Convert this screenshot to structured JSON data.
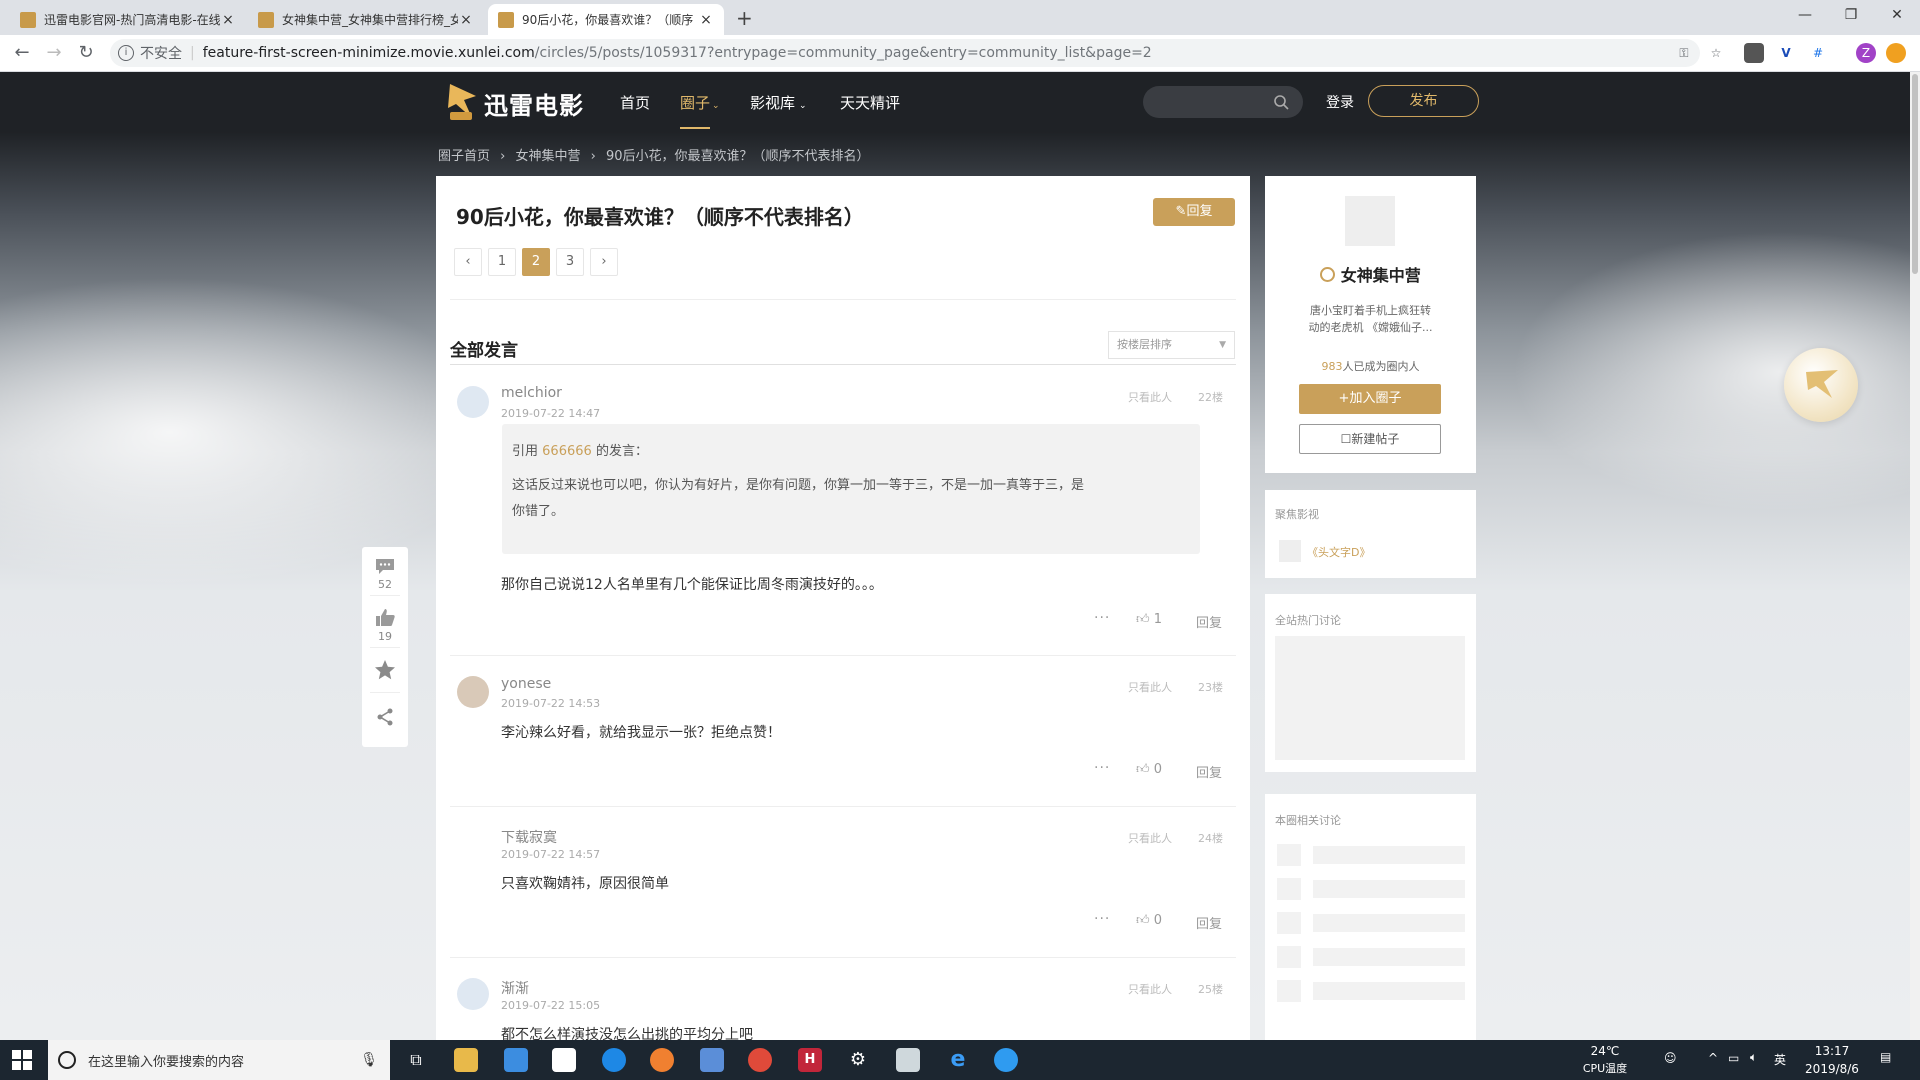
{
  "browser": {
    "tabs": [
      {
        "title": "迅雷电影官网-热门高清电影-在线"
      },
      {
        "title": "女神集中营_女神集中营排行榜_女"
      },
      {
        "title": "90后小花，你最喜欢谁？（顺序"
      }
    ],
    "new_tab": "+",
    "close_glyph": "×",
    "window": {
      "minimize": "—",
      "maximize": "❐",
      "close": "✕"
    },
    "nav": {
      "back": "←",
      "forward": "→",
      "reload": "↻"
    },
    "security_label": "不安全",
    "url_host": "feature-first-screen-minimize.movie.xunlei.com",
    "url_path": "/circles/5/posts/1059317?entrypage=community_page&entry=community_list&page=2",
    "profile_initial": "Z"
  },
  "site": {
    "logo_text": "迅雷电影",
    "nav": [
      "首页",
      "圈子",
      "影视库",
      "天天精评"
    ],
    "nav_active_index": 1,
    "login": "登录",
    "publish": "发布",
    "accent_color": "#c9a05a"
  },
  "breadcrumb": [
    "圈子首页",
    "女神集中营",
    "90后小花，你最喜欢谁？（顺序不代表排名）"
  ],
  "post": {
    "title": "90后小花，你最喜欢谁？（顺序不代表排名）",
    "reply_button": "回复",
    "pages": [
      "1",
      "2",
      "3"
    ],
    "current_page": "2",
    "prev": "‹",
    "next": "›"
  },
  "comments_header": {
    "title": "全部发言",
    "sort": "按楼层排序"
  },
  "comments": [
    {
      "user": "melchior",
      "time": "2019-07-22 14:47",
      "only": "只看此人",
      "floor": "22楼",
      "quote_prefix": "引用",
      "quote_user": "666666",
      "quote_suffix": "的发言：",
      "quote_text_1": "这话反过来说也可以吧，你认为有好片，是你有问题，你算一加一等于三，不是一加一真等于三，是",
      "quote_text_2": "你错了。",
      "text": "那你自己说说12人名单里有几个能保证比周冬雨演技好的。。。",
      "more": "···",
      "likes": "1",
      "reply": "回复"
    },
    {
      "user": "yonese",
      "time": "2019-07-22 14:53",
      "only": "只看此人",
      "floor": "23楼",
      "text": "李沁辣么好看，就给我显示一张？拒绝点赞！",
      "more": "···",
      "likes": "0",
      "reply": "回复"
    },
    {
      "user": "下载寂寞",
      "time": "2019-07-22 14:57",
      "only": "只看此人",
      "floor": "24楼",
      "text": "只喜欢鞠婧祎，原因很简单",
      "more": "···",
      "likes": "0",
      "reply": "回复"
    },
    {
      "user": "渐渐",
      "time": "2019-07-22 15:05",
      "only": "只看此人",
      "floor": "25楼",
      "text": "都不怎么样演技没怎么出挑的平均分上吧"
    }
  ],
  "side_actions": {
    "comments": "52",
    "likes": "19"
  },
  "circle": {
    "name": "女神集中营",
    "desc_1": "唐小宝盯着手机上疯狂转",
    "desc_2": "动的老虎机 《嫦娥仙子...",
    "member_count": "983",
    "member_suffix": "人已成为圈内人",
    "join": "+加入圈子",
    "new_post": "新建帖子"
  },
  "focus": {
    "title": "聚焦影视",
    "item": "《头文字D》"
  },
  "hot": {
    "title": "全站热门讨论"
  },
  "related": {
    "title": "本圈相关讨论"
  },
  "taskbar": {
    "search_placeholder": "在这里输入你要搜索的内容",
    "temp": "24℃",
    "cpu": "CPU温度",
    "ime": "英",
    "time": "13:17",
    "date": "2019/8/6"
  }
}
